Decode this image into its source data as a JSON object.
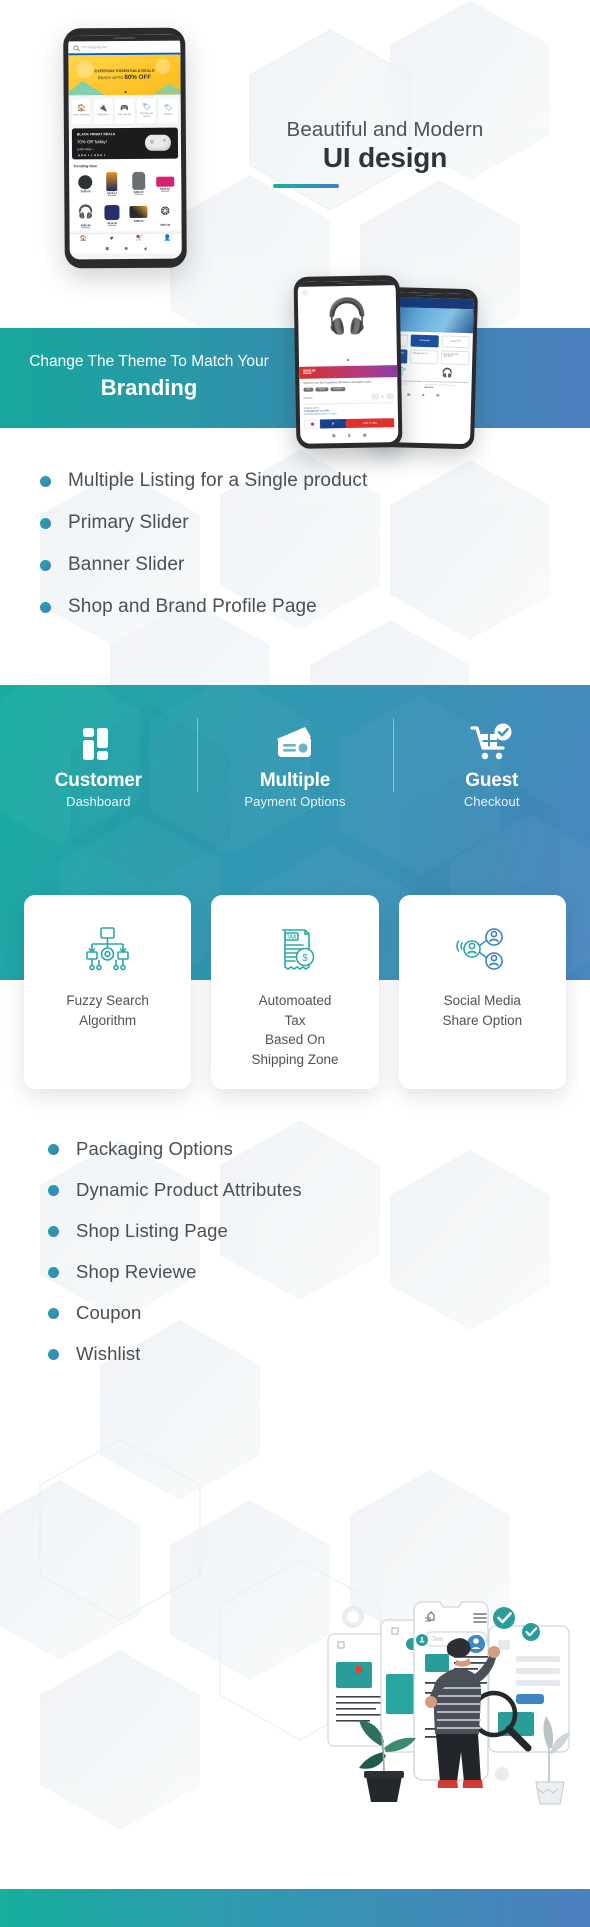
{
  "hero": {
    "title_line1": "Beautiful and Modern",
    "title_line2": "UI design",
    "phone": {
      "search_placeholder": "I'm shopping for ..",
      "promo_line1": "EVERYDAY ESSENTIALS DEALS",
      "promo_line2": "ENJOY UPTO ",
      "promo_discount": "60% OFF",
      "categories": [
        {
          "icon": "home-icon",
          "label": "Home & Garden"
        },
        {
          "icon": "plug-icon",
          "label": "Electronics"
        },
        {
          "icon": "gamepad-icon",
          "label": "Kids and Toy"
        },
        {
          "icon": "tag-icon",
          "label": "Clothing and Shoes"
        },
        {
          "icon": "tag-icon",
          "label": "Beauty"
        }
      ],
      "deal_title": "BLACK FRIDAY DEALS",
      "deal_sub": "70% Off Today!",
      "deal_cta": "SHOP NOW >",
      "trending_heading": "Trending Now",
      "products_row1": [
        {
          "price": "$298.00",
          "old": ""
        },
        {
          "price": "$378.17",
          "old": "$489.99"
        },
        {
          "price": "$402.00",
          "old": "$484.00"
        },
        {
          "price": "$194.32",
          "old": "$234.01"
        }
      ],
      "products_row2": [
        {
          "price": "$269.99",
          "old": "$434.00"
        },
        {
          "price": "$414.00",
          "old": "$501.48"
        },
        {
          "price": "$382.00",
          "old": ""
        },
        {
          "price": "$397.68",
          "old": ""
        }
      ],
      "navbar": [
        "home-icon",
        "heart-icon",
        "cart-icon",
        "account-icon"
      ]
    }
  },
  "branding_banner": {
    "line1": "Change The Theme To Match Your",
    "line2": "Branding",
    "phone_detail": {
      "price": "$268.99",
      "price_old": "$468.00",
      "product_title": "Wireless Over-Ear Headphone with Noise Cancellation, Black",
      "tags": [
        "New",
        "Popular",
        "Bestseller"
      ],
      "quantity_label": "Quantity",
      "quantity_value": "1",
      "shipping_title": "Shipping: $3.00",
      "shipping_to": "To Bangladesh via USPS",
      "shipping_note": "Estimated delivery time 7-15 days",
      "add_to_cart": "Add To Cart"
    },
    "phone_category": {
      "header": "Electronics",
      "chips": [
        "Mobile",
        "Computer",
        "Smart TV"
      ],
      "cards": [
        "Headphone with Noise Cancel",
        "Refrigerator Lg",
        "Beauty Blender $18-$170"
      ]
    }
  },
  "features_list_1": [
    "Multiple Listing for a Single product",
    "Primary Slider",
    "Banner Slider",
    "Shop and Brand Profile Page"
  ],
  "feature_highlights": [
    {
      "icon": "dashboard-icon",
      "title": "Customer",
      "subtitle": "Dashboard"
    },
    {
      "icon": "wallet-card-icon",
      "title": "Multiple",
      "subtitle": "Payment  Options"
    },
    {
      "icon": "cart-check-icon",
      "title": "Guest",
      "subtitle": "Checkout"
    }
  ],
  "feature_cards": [
    {
      "icon": "fuzzy-search-network-icon",
      "text": "Fuzzy Search\nAlgorithm"
    },
    {
      "icon": "tax-document-icon",
      "text": "Automoated\nTax\nBased On\nShipping Zone"
    },
    {
      "icon": "social-share-icon",
      "text": "Social Media\nShare Option"
    }
  ],
  "features_list_2": [
    "Packaging Options",
    "Dynamic  Product Attributes",
    "Shop Listing Page",
    "Shop Reviewe",
    "Coupon",
    "Wishlist"
  ],
  "colors": {
    "teal": "#17a79d",
    "blue": "#4c7fbe",
    "text_dark": "#2f363b",
    "text_body": "#494f54",
    "accent_gradient_start": "#1fa9a0",
    "accent_gradient_end": "#3f7fc1"
  }
}
